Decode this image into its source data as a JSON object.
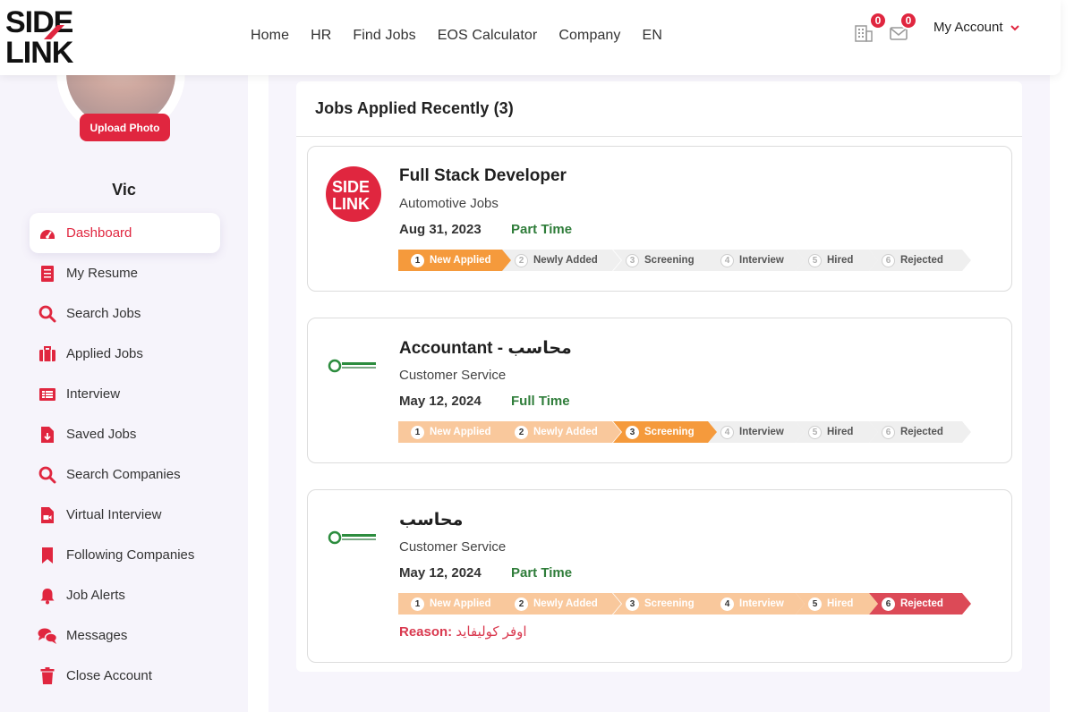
{
  "header": {
    "logo_text_top": "SIDE",
    "logo_text_bottom": "LINK",
    "nav": [
      "Home",
      "HR",
      "Find Jobs",
      "EOS Calculator",
      "Company",
      "EN"
    ],
    "notif_count": "0",
    "message_count": "0",
    "account_label": "My Account",
    "brand_color": "#e0263f"
  },
  "sidebar": {
    "upload_label": "Upload Photo",
    "user_name": "Vic",
    "items": [
      {
        "label": "Dashboard",
        "icon": "dashboard-icon",
        "active": true
      },
      {
        "label": "My Resume",
        "icon": "resume-icon"
      },
      {
        "label": "Search Jobs",
        "icon": "search-icon"
      },
      {
        "label": "Applied Jobs",
        "icon": "briefcase-icon"
      },
      {
        "label": "Interview",
        "icon": "interview-icon"
      },
      {
        "label": "Saved Jobs",
        "icon": "saved-file-icon"
      },
      {
        "label": "Search Companies",
        "icon": "search-icon"
      },
      {
        "label": "Virtual Interview",
        "icon": "video-file-icon"
      },
      {
        "label": "Following Companies",
        "icon": "bookmark-icon"
      },
      {
        "label": "Job Alerts",
        "icon": "bell-icon"
      },
      {
        "label": "Messages",
        "icon": "chat-icon"
      },
      {
        "label": "Close Account",
        "icon": "trash-icon"
      }
    ]
  },
  "main": {
    "title": "Jobs Applied Recently (3)",
    "stage_labels": [
      "New Applied",
      "Newly Added",
      "Screening",
      "Interview",
      "Hired",
      "Rejected"
    ],
    "jobs": [
      {
        "title": "Full Stack Developer",
        "category": "Automotive Jobs",
        "date": "Aug 31, 2023",
        "type": "Part Time",
        "logo": "sidelink-logo",
        "current_stage": 1,
        "rejected": false
      },
      {
        "title": "Accountant - محاسب",
        "category": "Customer Service",
        "date": "May 12, 2024",
        "type": "Full Time",
        "logo": "company-logo",
        "current_stage": 3,
        "rejected": false
      },
      {
        "title": "محاسب",
        "category": "Customer Service",
        "date": "May 12, 2024",
        "type": "Part Time",
        "logo": "company-logo",
        "current_stage": 6,
        "rejected": true,
        "reason_label": "Reason:",
        "reason_text": "اوفر كوليفايد"
      }
    ]
  }
}
